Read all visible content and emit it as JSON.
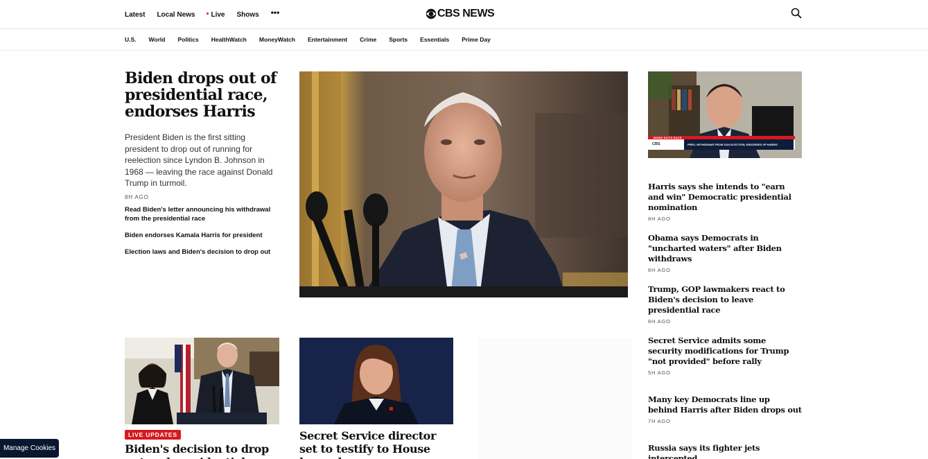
{
  "header": {
    "nav": [
      {
        "label": "Latest"
      },
      {
        "label": "Local News"
      },
      {
        "label": "Live"
      },
      {
        "label": "Shows"
      }
    ],
    "more_label": "•••",
    "logo_text": "CBS NEWS",
    "search_icon": "search-icon"
  },
  "subnav": [
    "U.S.",
    "World",
    "Politics",
    "HealthWatch",
    "MoneyWatch",
    "Entertainment",
    "Crime",
    "Sports",
    "Essentials",
    "Prime Day"
  ],
  "lead": {
    "headline": "Biden drops out of presidential race, endorses Harris",
    "dek": "President Biden is the first sitting president to drop out of running for reelection since Lyndon B. Johnson in 1968 — leaving the race against Donald Trump in turmoil.",
    "time": "8H AGO",
    "related": [
      "Read Biden's letter announcing his withdrawal from the presidential race",
      "Biden endorses Kamala Harris for president",
      "Election laws and Biden's decision to drop out"
    ]
  },
  "video": {
    "chyron_tag": "BIDEN EXITS RACE",
    "chyron_text": "PRES. WITHDRAWS FROM 2024 ELECTION, ENDORSES VP HARRIS",
    "chyron_logo": "CBS"
  },
  "right_list": [
    {
      "headline": "Harris says she intends to \"earn and win\" Democratic presidential nomination",
      "time": "8H AGO"
    },
    {
      "headline": "Obama says Democrats in \"uncharted waters\" after Biden withdraws",
      "time": "8H AGO"
    },
    {
      "headline": "Trump, GOP lawmakers react to Biden's decision to leave presidential race",
      "time": "8H AGO"
    },
    {
      "headline": "Secret Service admits some security modifications for Trump \"not provided\" before rally",
      "time": "5H AGO"
    },
    {
      "headline": "Many key Democrats line up behind Harris after Biden drops out",
      "time": "7H AGO"
    },
    {
      "headline": "Russia says its fighter jets intercepted",
      "time": ""
    }
  ],
  "cards": [
    {
      "badge": "LIVE UPDATES",
      "headline": "Biden's decision to drop out and presidential"
    },
    {
      "headline": "Secret Service director set to testify to House lawmakers"
    }
  ],
  "cookies_label": "Manage Cookies",
  "colors": {
    "accent": "#d71920",
    "cookie_bg": "#0b1731"
  }
}
